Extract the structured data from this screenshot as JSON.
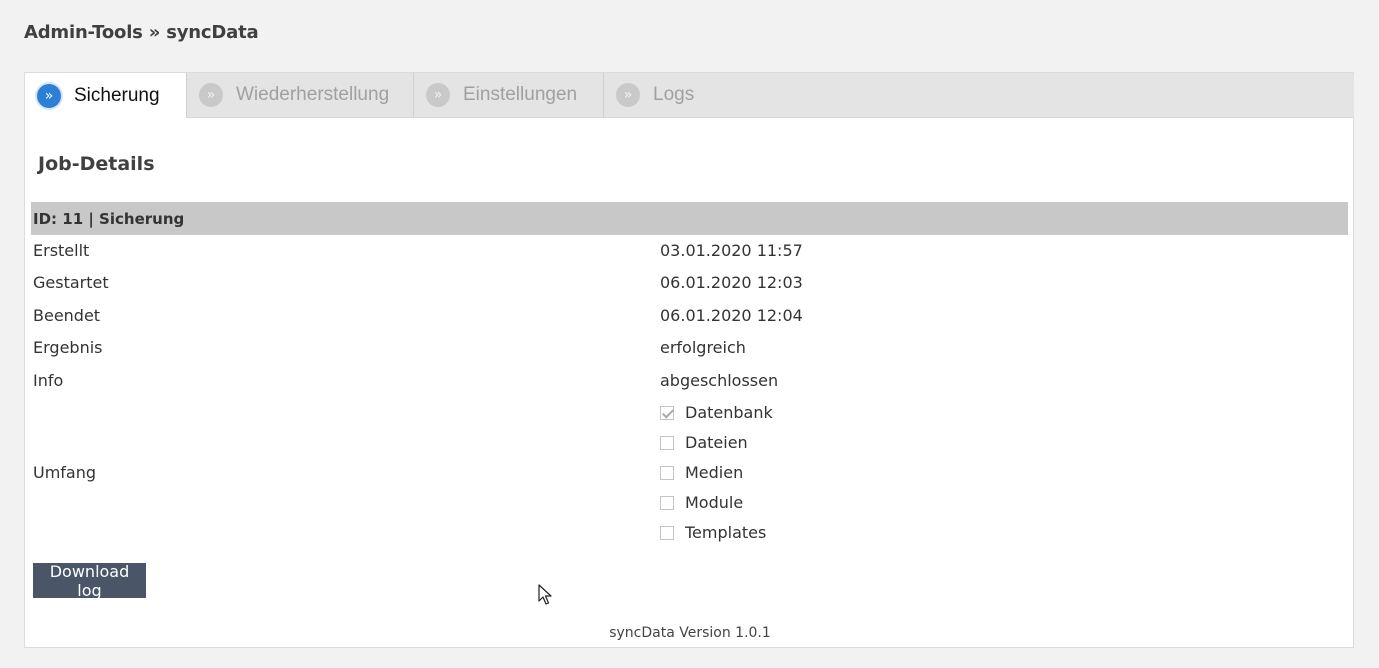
{
  "breadcrumb": "Admin-Tools » syncData",
  "tabs": [
    {
      "label": "Sicherung",
      "active": true
    },
    {
      "label": "Wiederherstellung",
      "active": false
    },
    {
      "label": "Einstellungen",
      "active": false
    },
    {
      "label": "Logs",
      "active": false
    }
  ],
  "tab_bullet": "»",
  "job": {
    "title": "Job-Details",
    "header": "ID: 11 | Sicherung",
    "rows": [
      {
        "label": "Erstellt",
        "value": "03.01.2020 11:57"
      },
      {
        "label": "Gestartet",
        "value": "06.01.2020 12:03"
      },
      {
        "label": "Beendet",
        "value": "06.01.2020 12:04"
      },
      {
        "label": "Ergebnis",
        "value": "erfolgreich"
      },
      {
        "label": "Info",
        "value": "abgeschlossen"
      }
    ],
    "scope_label": "Umfang",
    "scope": [
      {
        "label": "Datenbank",
        "checked": true
      },
      {
        "label": "Dateien",
        "checked": false
      },
      {
        "label": "Medien",
        "checked": false
      },
      {
        "label": "Module",
        "checked": false
      },
      {
        "label": "Templates",
        "checked": false
      }
    ]
  },
  "download_button": "Download log",
  "footer": "syncData Version 1.0.1",
  "colors": {
    "active_bullet": "#2b7fd6",
    "button_bg": "#4a5568",
    "id_bar_bg": "#c8c8c8"
  }
}
